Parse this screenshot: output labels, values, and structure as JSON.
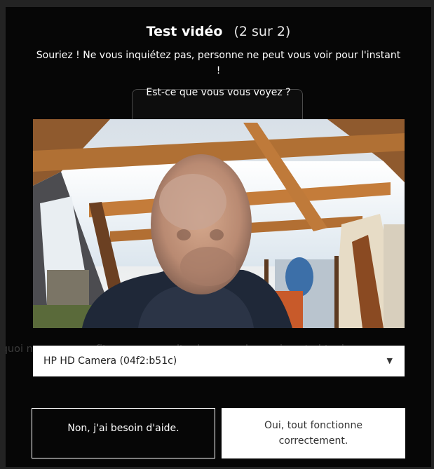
{
  "dialog": {
    "title": "Test vidéo",
    "step": "(2 sur 2)",
    "subtitle": "Souriez ! Ne vous inquiétez pas, personne ne peut vous voir pour l'instant !",
    "question": "Est-ce que vous vous voyez ?",
    "background_text": "rquoi ne pas en profiter pour consulter le menu de session et obtenir un aperç"
  },
  "video": {
    "description": "camera-preview"
  },
  "camera_select": {
    "selected": "HP HD Camera (04f2:b51c)",
    "arrow_icon": "triangle-down-icon"
  },
  "buttons": {
    "help_label": "Non, j'ai besoin d'aide.",
    "ok_label": "Oui, tout fonctionne correctement."
  }
}
